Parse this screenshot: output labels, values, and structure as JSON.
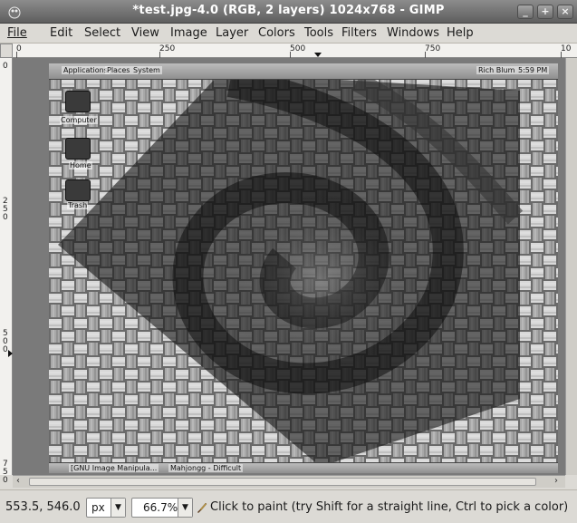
{
  "window": {
    "title": "*test.jpg-4.0 (RGB, 2 layers) 1024x768 - GIMP",
    "minimize": "_",
    "maximize": "+",
    "close": "×"
  },
  "menu": {
    "items": [
      "File",
      "Edit",
      "Select",
      "View",
      "Image",
      "Layer",
      "Colors",
      "Tools",
      "Filters",
      "Windows",
      "Help"
    ]
  },
  "ruler": {
    "h_labels": [
      "0",
      "250",
      "500",
      "750",
      "10"
    ],
    "v_labels": [
      "0",
      "250",
      "500",
      "750"
    ]
  },
  "image_content": {
    "panel_menus": [
      "Applications",
      "Places",
      "System"
    ],
    "panel_user": "Rich Blum",
    "panel_time": "5:59 PM",
    "desktop_icons": [
      "Computer",
      "Home",
      "Trash"
    ],
    "taskbar_items": [
      "[GNU Image Manipula...",
      "Mahjongg - Difficult"
    ]
  },
  "status": {
    "coords": "553.5, 546.0",
    "unit": "px",
    "zoom": "66.7%",
    "message": "Click to paint (try Shift for a straight line, Ctrl to pick a color)"
  },
  "colors": {
    "titlebar": "#5e5e5e",
    "background": "#dcdad5"
  }
}
